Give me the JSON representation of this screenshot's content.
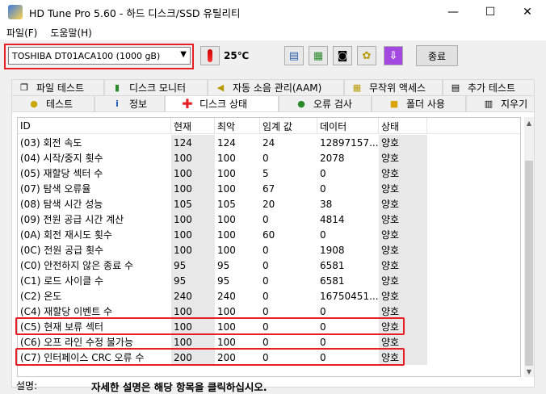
{
  "window": {
    "title": "HD Tune Pro 5.60 - 하드 디스크/SSD 유틸리티",
    "minimize": "—",
    "maximize": "☐",
    "close": "✕"
  },
  "menu": [
    {
      "label": "파일(F)"
    },
    {
      "label": "도움말(H)"
    }
  ],
  "toolbar": {
    "drive": "TOSHIBA DT01ACA100 (1000 gB)",
    "temperature": "25℃",
    "exit_label": "종료",
    "icons": [
      "copy-icon",
      "copy-screen-icon",
      "camera-icon",
      "options-icon",
      "download-icon"
    ]
  },
  "tabs_top": [
    {
      "label": "파일 테스트",
      "icon": "file-test-icon"
    },
    {
      "label": "디스크 모니터",
      "icon": "disk-monitor-icon"
    },
    {
      "label": "자동 소음 관리(AAM)",
      "icon": "speaker-icon"
    },
    {
      "label": "무작위 액세스",
      "icon": "random-access-icon"
    },
    {
      "label": "추가 테스트",
      "icon": "extra-tests-icon"
    }
  ],
  "tabs_bottom": [
    {
      "label": "테스트",
      "icon": "benchmark-icon"
    },
    {
      "label": "정보",
      "icon": "info-icon"
    },
    {
      "label": "디스크 상태",
      "icon": "health-cross-icon",
      "active": true
    },
    {
      "label": "오류 검사",
      "icon": "magnifier-icon"
    },
    {
      "label": "폴더 사용",
      "icon": "folder-icon"
    },
    {
      "label": "지우기",
      "icon": "trash-icon"
    }
  ],
  "table": {
    "headers": [
      "ID",
      "현재",
      "최악",
      "임계 값",
      "데이터",
      "상태"
    ],
    "rows": [
      [
        "(03) 회전 속도",
        "124",
        "124",
        "24",
        "12897157...",
        "양호"
      ],
      [
        "(04) 시작/중지 횟수",
        "100",
        "100",
        "0",
        "2078",
        "양호"
      ],
      [
        "(05) 재할당 섹터 수",
        "100",
        "100",
        "5",
        "0",
        "양호"
      ],
      [
        "(07) 탐색 오류율",
        "100",
        "100",
        "67",
        "0",
        "양호"
      ],
      [
        "(08) 탐색 시간 성능",
        "105",
        "105",
        "20",
        "38",
        "양호"
      ],
      [
        "(09) 전원 공급 시간 계산",
        "100",
        "100",
        "0",
        "4814",
        "양호"
      ],
      [
        "(0A) 회전 재시도 횟수",
        "100",
        "100",
        "60",
        "0",
        "양호"
      ],
      [
        "(0C) 전원 공급 횟수",
        "100",
        "100",
        "0",
        "1908",
        "양호"
      ],
      [
        "(C0) 안전하지 않은 종료 수",
        "95",
        "95",
        "0",
        "6581",
        "양호"
      ],
      [
        "(C1) 로드 사이클 수",
        "95",
        "95",
        "0",
        "6581",
        "양호"
      ],
      [
        "(C2) 온도",
        "240",
        "240",
        "0",
        "16750451...",
        "양호"
      ],
      [
        "(C4) 재할당 이벤트 수",
        "100",
        "100",
        "0",
        "0",
        "양호"
      ],
      [
        "(C5) 현재 보류 섹터",
        "100",
        "100",
        "0",
        "0",
        "양호"
      ],
      [
        "(C6) 오프 라인 수정 불가능",
        "100",
        "100",
        "0",
        "0",
        "양호"
      ],
      [
        "(C7) 인터페이스 CRC 오류 수",
        "200",
        "200",
        "0",
        "0",
        "양호"
      ]
    ]
  },
  "footer": {
    "label": "설명:",
    "text": "자세한 설명은 해당 항목을 클릭하십시오."
  }
}
